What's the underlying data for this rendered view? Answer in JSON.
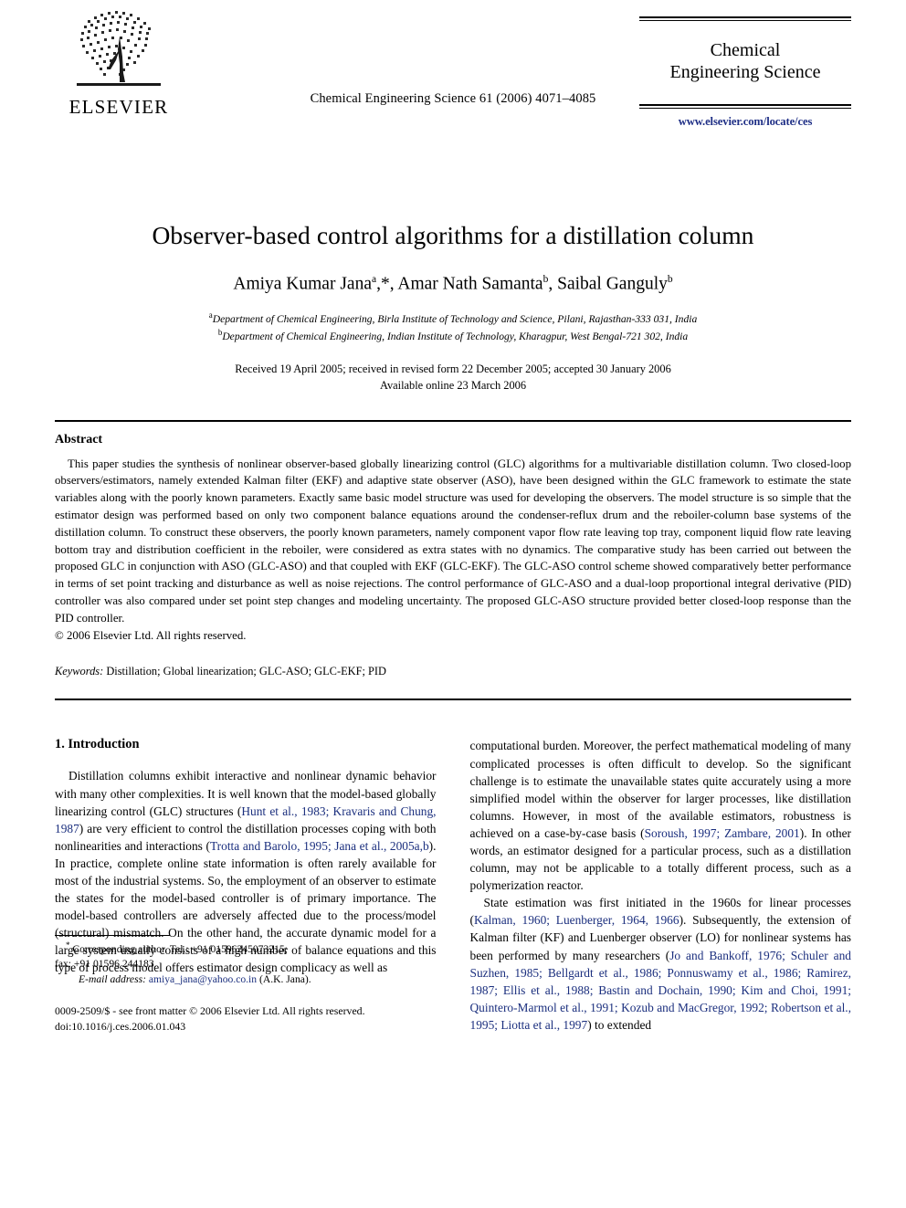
{
  "header": {
    "publisher_logo_name": "ELSEVIER",
    "journal_reference": "Chemical Engineering Science 61 (2006) 4071–4085",
    "journal_name": "Chemical\nEngineering Science",
    "journal_url": "www.elsevier.com/locate/ces"
  },
  "article": {
    "title": "Observer-based control algorithms for a distillation column",
    "authors_html": "Amiya Kumar Jana<sup>a</sup>,*, Amar Nath Samanta<sup>b</sup>, Saibal Ganguly<sup>b</sup>",
    "affiliation_a_marker": "a",
    "affiliation_a": "Department of Chemical Engineering, Birla Institute of Technology and Science, Pilani, Rajasthan-333 031, India",
    "affiliation_b_marker": "b",
    "affiliation_b": "Department of Chemical Engineering, Indian Institute of Technology, Kharagpur, West Bengal-721 302, India",
    "received_line": "Received 19 April 2005; received in revised form 22 December 2005; accepted 30 January 2006",
    "available_line": "Available online 23 March 2006"
  },
  "abstract": {
    "heading": "Abstract",
    "text": "This paper studies the synthesis of nonlinear observer-based globally linearizing control (GLC) algorithms for a multivariable distillation column. Two closed-loop observers/estimators, namely extended Kalman filter (EKF) and adaptive state observer (ASO), have been designed within the GLC framework to estimate the state variables along with the poorly known parameters. Exactly same basic model structure was used for developing the observers. The model structure is so simple that the estimator design was performed based on only two component balance equations around the condenser-reflux drum and the reboiler-column base systems of the distillation column. To construct these observers, the poorly known parameters, namely component vapor flow rate leaving top tray, component liquid flow rate leaving bottom tray and distribution coefficient in the reboiler, were considered as extra states with no dynamics. The comparative study has been carried out between the proposed GLC in conjunction with ASO (GLC-ASO) and that coupled with EKF (GLC-EKF). The GLC-ASO control scheme showed comparatively better performance in terms of set point tracking and disturbance as well as noise rejections. The control performance of GLC-ASO and a dual-loop proportional integral derivative (PID) controller was also compared under set point step changes and modeling uncertainty. The proposed GLC-ASO structure provided better closed-loop response than the PID controller.",
    "copyright": "© 2006 Elsevier Ltd. All rights reserved.",
    "keywords_label": "Keywords:",
    "keywords_value": "Distillation; Global linearization; GLC-ASO; GLC-EKF; PID"
  },
  "body": {
    "section_heading": "1. Introduction",
    "left_paragraph_1": [
      {
        "t": "Distillation columns exhibit interactive and nonlinear dynamic behavior with many other complexities. It is well known that the model-based globally linearizing control (GLC) structures (",
        "c": false
      },
      {
        "t": "Hunt et al., 1983; Kravaris and Chung, 1987",
        "c": true
      },
      {
        "t": ") are very efficient to control the distillation processes coping with both nonlinearities and interactions (",
        "c": false
      },
      {
        "t": "Trotta and Barolo, 1995; Jana et al., 2005a,b",
        "c": true
      },
      {
        "t": "). In practice, complete online state information is often rarely available for most of the industrial systems. So, the employment of an observer to estimate the states for the model-based controller is of primary importance. The model-based controllers are adversely affected due to the process/model (structural) mismatch. On the other hand, the accurate dynamic model for a large system usually consists of a high number of balance equations and this type of process model offers estimator design complicacy as well as",
        "c": false
      }
    ],
    "right_paragraph_1": [
      {
        "t": "computational burden. Moreover, the perfect mathematical modeling of many complicated processes is often difficult to develop. So the significant challenge is to estimate the unavailable states quite accurately using a more simplified model within the observer for larger processes, like distillation columns. However, in most of the available estimators, robustness is achieved on a case-by-case basis (",
        "c": false
      },
      {
        "t": "Soroush, 1997; Zambare, 2001",
        "c": true
      },
      {
        "t": "). In other words, an estimator designed for a particular process, such as a distillation column, may not be applicable to a totally different process, such as a polymerization reactor.",
        "c": false
      }
    ],
    "right_paragraph_2": [
      {
        "t": "State estimation was first initiated in the 1960s for linear processes (",
        "c": false
      },
      {
        "t": "Kalman, 1960; Luenberger, 1964, 1966",
        "c": true
      },
      {
        "t": "). Subsequently, the extension of Kalman filter (KF) and Luenberger observer (LO) for nonlinear systems has been performed by many researchers (",
        "c": false
      },
      {
        "t": "Jo and Bankoff, 1976; Schuler and Suzhen, 1985; Bellgardt et al., 1986; Ponnuswamy et al., 1986; Ramirez, 1987; Ellis et al., 1988; Bastin and Dochain, 1990; Kim and Choi, 1991; Quintero-Marmol et al., 1991; Kozub and MacGregor, 1992; Robertson et al., 1995; Liotta et al., 1997",
        "c": true
      },
      {
        "t": ") to extended",
        "c": false
      }
    ]
  },
  "footnotes": {
    "corresponding_marker": "*",
    "corresponding_line1": "Corresponding author. Tel.: +91 01596245073215;",
    "corresponding_line2": "fax: +91 01596 244183.",
    "email_label": "E-mail address:",
    "email_value": "amiya_jana@yahoo.co.in",
    "email_suffix": "(A.K. Jana).",
    "imprint_line1": "0009-2509/$ - see front matter © 2006 Elsevier Ltd. All rights reserved.",
    "imprint_line2": "doi:10.1016/j.ces.2006.01.043"
  },
  "colors": {
    "link": "#1b2f7e",
    "text": "#000000",
    "background": "#ffffff"
  }
}
